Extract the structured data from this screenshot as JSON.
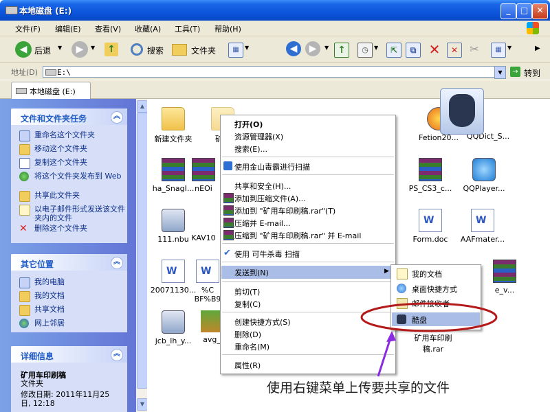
{
  "window": {
    "title": "本地磁盘 (E:)",
    "minimize": "_",
    "maximize": "□",
    "close": "✕"
  },
  "menubar": {
    "items": [
      "文件(F)",
      "编辑(E)",
      "查看(V)",
      "收藏(A)",
      "工具(T)",
      "帮助(H)"
    ]
  },
  "toolbar": {
    "back_label": "后退",
    "search_label": "搜索",
    "folders_label": "文件夹"
  },
  "address": {
    "label": "地址(D)",
    "value": "E:\\",
    "go_label": "转到"
  },
  "tab": {
    "label": "本地磁盘 (E:)"
  },
  "tasks_panel": {
    "title": "文件和文件夹任务",
    "items": [
      "重命名这个文件夹",
      "移动这个文件夹",
      "复制这个文件夹",
      "将这个文件夹发布到 Web",
      "共享此文件夹",
      "以电子邮件形式发送该文件夹内的文件",
      "删除这个文件夹"
    ]
  },
  "places_panel": {
    "title": "其它位置",
    "items": [
      "我的电脑",
      "我的文档",
      "共享文档",
      "网上邻居"
    ]
  },
  "details_panel": {
    "title": "详细信息",
    "name": "矿用车印刷稿",
    "type": "文件夹",
    "modified": "修改日期: 2011年11月25日, 12:18"
  },
  "files": {
    "new_folder": "新建文件夹",
    "selected_folder": "矿用",
    "ha_snag": "ha_SnagI...",
    "neo": "nEOi",
    "nbu": "111.nbu",
    "kav": "KAV10",
    "doc2007": "20071130...",
    "pct": "%C BF%B9",
    "jcb": "jcb_lh_y...",
    "avg": "avg_",
    "fetion": "Fetion20...",
    "qqdict": "QQDict_S...",
    "ps_cs3": "PS_CS3_c...",
    "qqplayer": "QQPlayer...",
    "form_doc": "Form.doc",
    "aafmater": "AAFmater...",
    "e_v": "e_v...",
    "rar_kuangyong": "矿用车印刷稿.rar"
  },
  "context_menu": {
    "open": "打开(O)",
    "explorer": "资源管理器(X)",
    "search": "搜索(E)...",
    "kingsoft": "使用金山毒霸进行扫描",
    "share": "共享和安全(H)...",
    "add_archive": "添加到压缩文件(A)...",
    "add_rar": "添加到 \"矿用车印刷稿.rar\"(T)",
    "compress_email": "压缩并 E-mail...",
    "compress_rar_email": "压缩到 \"矿用车印刷稿.rar\" 并 E-mail",
    "keniu": "使用 可牛杀毒 扫描",
    "send_to": "发送到(N)",
    "cut": "剪切(T)",
    "copy": "复制(C)",
    "shortcut": "创建快捷方式(S)",
    "delete": "删除(D)",
    "rename": "重命名(M)",
    "properties": "属性(R)"
  },
  "submenu": {
    "items": [
      "我的文档",
      "桌面快捷方式",
      "邮件接收者",
      "酷盘"
    ]
  },
  "annotation": {
    "text": "使用右键菜单上传要共享的文件",
    "color": "#b51a1a"
  }
}
